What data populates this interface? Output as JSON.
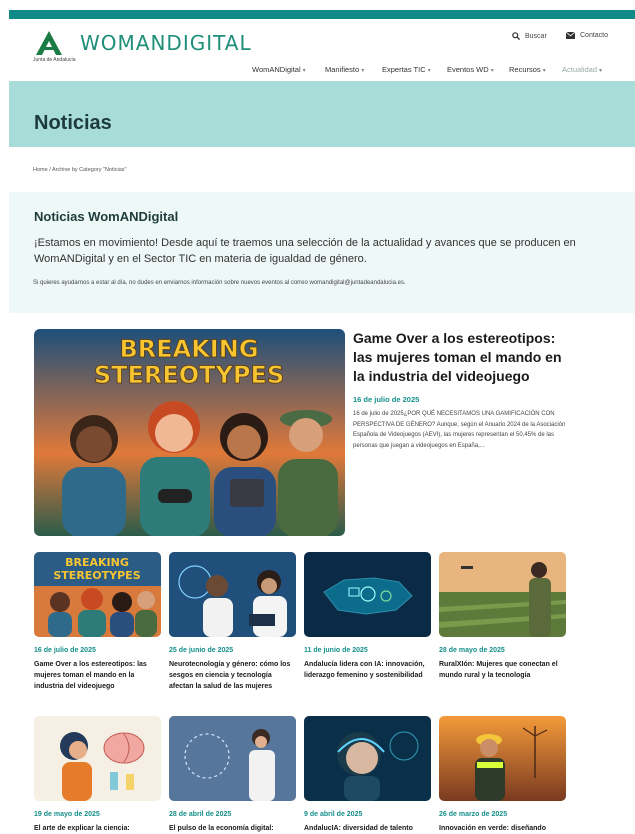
{
  "brand": {
    "name": "WOMANDIGITAL",
    "sub": "Junta de Andalucía"
  },
  "utility": {
    "search": "Buscar",
    "contact": "Contacto"
  },
  "nav": [
    "WomANDigital",
    "Manifiesto",
    "Expertas TIC",
    "Eventos WD",
    "Recursos",
    "Actualidad"
  ],
  "page_title": "Noticias",
  "breadcrumb": "Home / Archive by Category \"Noticias\"",
  "intro": {
    "heading": "Noticias WomANDigital",
    "lead": "¡Estamos en movimiento! Desde aquí te traemos una selección de la actualidad y avances que se producen en WomANDigital y en el Sector TIC en materia de igualdad de género.",
    "small": "Si quieres ayudarnos a estar al día, no dudes en enviarnos información sobre nuevos eventos al correo womandigital@juntadeandalucia.es."
  },
  "featured": {
    "image_text": [
      "BREAKING",
      "STEREOTYPES"
    ],
    "title": "Game Over a los estereotipos: las mujeres toman el mando en la industria del videojuego",
    "date": "16 de julio de 2025",
    "excerpt": "16 de julio de 2025¿POR QUÉ NECESITAMOS UNA GAMIFICACIÓN CON PERSPECTIVA DE GÉNERO? Aunque, según el Anuario 2024 de la Asociación Española de Videojuegos (AEVI), las mujeres representan el 50,45% de las personas que juegan a videojuegos en España,..."
  },
  "cards": [
    {
      "date": "16 de julio de 2025",
      "title": "Game Over a los estereotipos: las mujeres toman el mando en la industria del videojuego"
    },
    {
      "date": "25 de junio de 2025",
      "title": "Neurotecnología y género: cómo los sesgos en ciencia y tecnología afectan la salud de las mujeres"
    },
    {
      "date": "11 de junio de 2025",
      "title": "Andalucía lidera con IA: innovación, liderazgo femenino y sostenibilidad"
    },
    {
      "date": "28 de mayo de 2025",
      "title": "RuralXIón: Mujeres que conectan el mundo rural y la tecnología"
    },
    {
      "date": "19 de mayo de 2025",
      "title": "El arte de explicar la ciencia:"
    },
    {
      "date": "28 de abril de 2025",
      "title": "El pulso de la economía digital:"
    },
    {
      "date": "9 de abril de 2025",
      "title": "AndalucIA: diversidad de talento"
    },
    {
      "date": "26 de marzo de 2025",
      "title": "Innovación en verde: diseñando"
    }
  ],
  "colors": {
    "accent": "#148f8a",
    "band": "#a8dcd8",
    "topbar": "#0f8a86",
    "intro_bg": "#eef8f7"
  }
}
